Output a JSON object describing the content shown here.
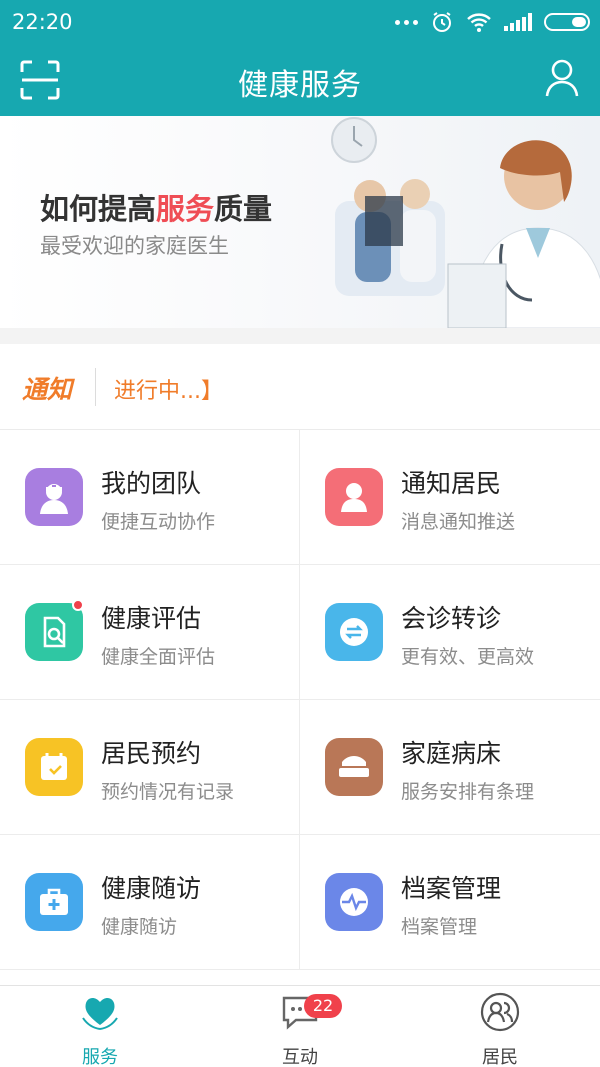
{
  "status_bar": {
    "time": "22:20"
  },
  "header": {
    "title": "健康服务"
  },
  "banner": {
    "headline_prefix": "如何提高",
    "headline_highlight": "服务",
    "headline_suffix": "质量",
    "subtitle": "最受欢迎的家庭医生"
  },
  "notice": {
    "tag": "通知",
    "text": "进行中...】",
    "color": "#f07c2a"
  },
  "services": [
    {
      "title": "我的团队",
      "subtitle": "便捷互动协作",
      "icon": "team-icon",
      "color": "#a87ee0"
    },
    {
      "title": "通知居民",
      "subtitle": "消息通知推送",
      "icon": "person-icon",
      "color": "#f46e77"
    },
    {
      "title": "健康评估",
      "subtitle": "健康全面评估",
      "icon": "assessment-icon",
      "color": "#2fc7a3"
    },
    {
      "title": "会诊转诊",
      "subtitle": "更有效、更高效",
      "icon": "transfer-icon",
      "color": "#49b6ea"
    },
    {
      "title": "居民预约",
      "subtitle": "预约情况有记录",
      "icon": "calendar-icon",
      "color": "#f7c325"
    },
    {
      "title": "家庭病床",
      "subtitle": "服务安排有条理",
      "icon": "bed-icon",
      "color": "#b97757"
    },
    {
      "title": "健康随访",
      "subtitle": "健康随访",
      "icon": "medical-kit-icon",
      "color": "#45a8ec"
    },
    {
      "title": "档案管理",
      "subtitle": "档案管理",
      "icon": "pulse-icon",
      "color": "#6b87e8"
    }
  ],
  "tabs": [
    {
      "label": "服务",
      "icon": "heart-hands-icon",
      "active": true
    },
    {
      "label": "互动",
      "icon": "chat-icon",
      "badge": "22"
    },
    {
      "label": "居民",
      "icon": "residents-icon"
    }
  ],
  "colors": {
    "brand": "#17a8b0",
    "badge": "#f0414b"
  }
}
